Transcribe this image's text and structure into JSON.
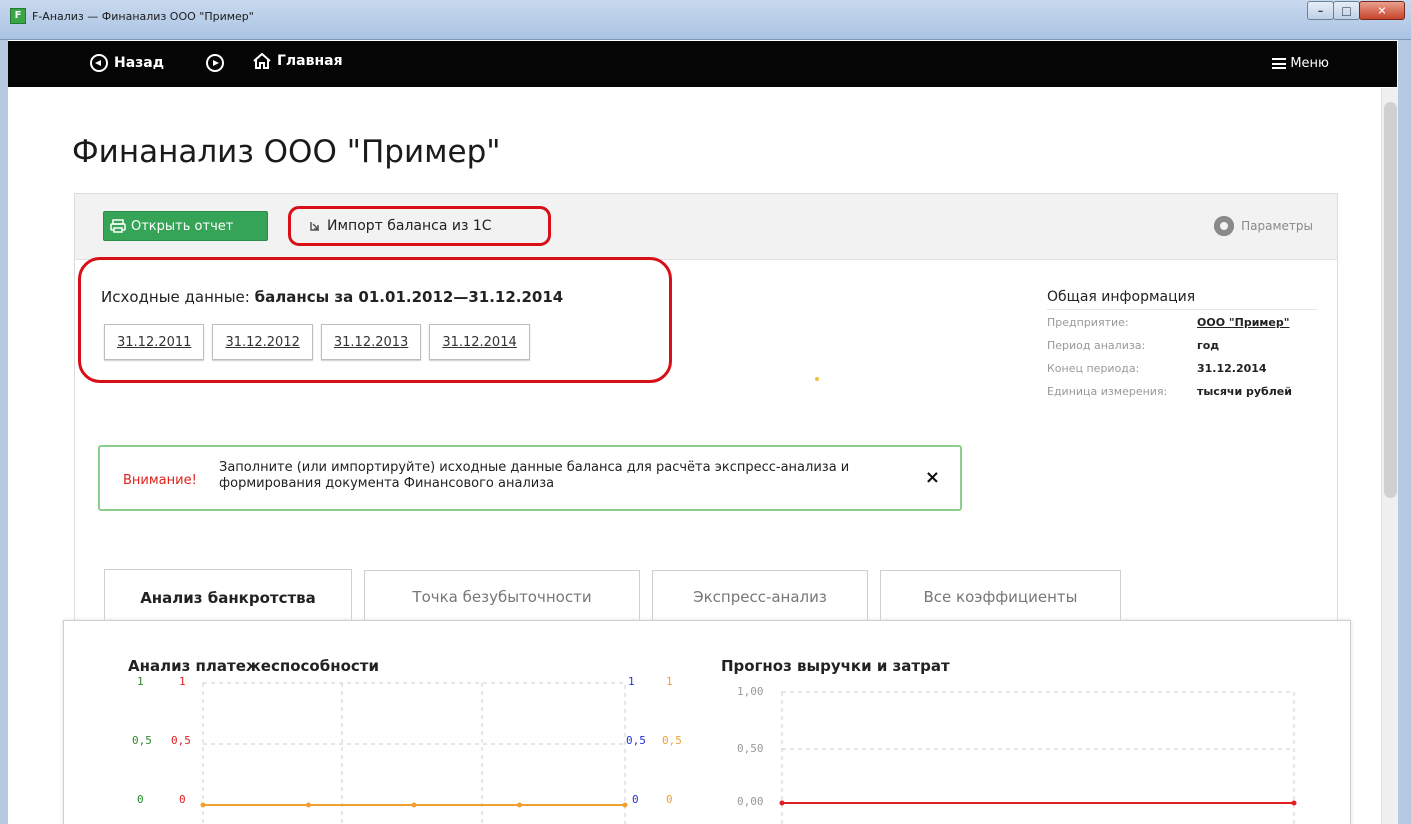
{
  "window": {
    "title": "F-Анализ — Финанализ ООО \"Пример\"",
    "app_icon": "F"
  },
  "nav": {
    "back": "Назад",
    "home": "Главная",
    "menu": "Меню"
  },
  "page": {
    "title": "Финанализ ООО \"Пример\""
  },
  "toolbar": {
    "open_report": "Открыть отчет",
    "import": "Импорт баланса из 1С",
    "params": "Параметры"
  },
  "source": {
    "label": "Исходные данные:",
    "value": "балансы за 01.01.2012—31.12.2014",
    "dates": [
      "31.12.2011",
      "31.12.2012",
      "31.12.2013",
      "31.12.2014"
    ]
  },
  "info": {
    "header": "Общая информация",
    "rows": [
      {
        "k": "Предприятие:",
        "v": "ООО \"Пример\""
      },
      {
        "k": "Период анализа:",
        "v": "год"
      },
      {
        "k": "Конец периода:",
        "v": "31.12.2014"
      },
      {
        "k": "Единица измерения:",
        "v": "тысячи рублей"
      }
    ]
  },
  "alert": {
    "warn": "Внимание!",
    "msg": "Заполните (или импортируйте) исходные данные баланса для расчёта экспресс-анализа и формирования документа Финансового анализа",
    "close": "×"
  },
  "tabs": [
    "Анализ банкротства",
    "Точка безубыточности",
    "Экспресс-анализ",
    "Все коэффициенты"
  ],
  "charts": {
    "left_title": "Анализ платежеспособности",
    "right_title": "Прогноз выручки и затрат"
  },
  "chart_data": [
    {
      "type": "line",
      "title": "Анализ платежеспособности",
      "axes": {
        "left_green": [
          "1",
          "0,5",
          "0"
        ],
        "left_red": [
          "1",
          "0,5",
          "0"
        ],
        "right_blue": [
          "1",
          "0,5",
          "0"
        ],
        "right_orange": [
          "1",
          "0,5",
          "0"
        ]
      },
      "ylim": [
        0,
        1
      ],
      "series": [
        {
          "color": "#f0a030",
          "values": [
            0,
            0,
            0,
            0,
            0
          ]
        }
      ]
    },
    {
      "type": "line",
      "title": "Прогноз выручки и затрат",
      "ytick_labels": [
        "1,00",
        "0,50",
        "0,00"
      ],
      "ylim": [
        0,
        1
      ],
      "series": [
        {
          "color": "#e02020",
          "values": [
            0,
            0
          ]
        }
      ]
    }
  ],
  "colors": {
    "accent_green": "#35a457",
    "highlight_red": "#d90f17",
    "warn_red": "#e0201a"
  }
}
